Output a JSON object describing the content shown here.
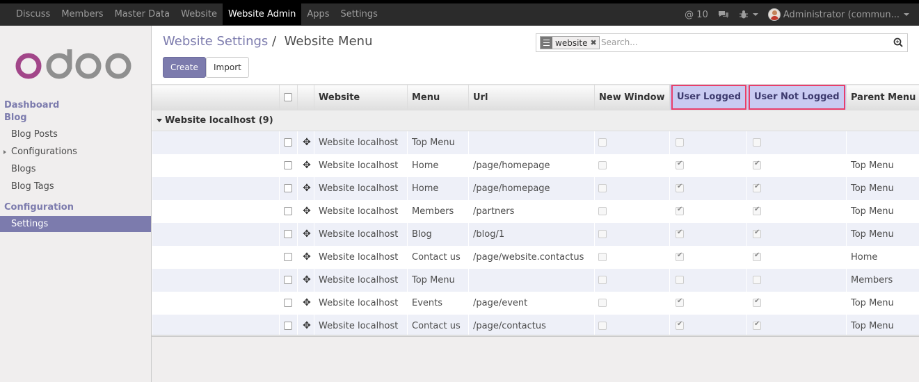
{
  "topbar": {
    "menu": [
      "Discuss",
      "Members",
      "Master Data",
      "Website",
      "Website Admin",
      "Apps",
      "Settings"
    ],
    "active_index": 4,
    "messages_count": "@ 10",
    "user": "Administrator (commun..."
  },
  "sidebar": {
    "sections": [
      {
        "title": "Dashboard"
      },
      {
        "title": "Blog",
        "items": [
          "Blog Posts",
          "Configurations",
          "Blogs",
          "Blog Tags"
        ]
      },
      {
        "title": "Configuration",
        "items": [
          "Settings"
        ]
      }
    ],
    "active": "Settings"
  },
  "breadcrumb": {
    "parent": "Website Settings",
    "sep": "/",
    "current": "Website Menu"
  },
  "buttons": {
    "create": "Create",
    "import": "Import"
  },
  "search": {
    "facet": "website",
    "placeholder": "Search..."
  },
  "table": {
    "columns": [
      "Website",
      "Menu",
      "Url",
      "New Window",
      "User Logged",
      "User Not Logged",
      "Parent Menu"
    ],
    "group_label": "Website localhost (9)",
    "rows": [
      {
        "website": "Website localhost",
        "menu": "Top Menu",
        "url": "",
        "new_window": false,
        "logged": false,
        "not_logged": false,
        "parent": ""
      },
      {
        "website": "Website localhost",
        "menu": "Home",
        "url": "/page/homepage",
        "new_window": false,
        "logged": true,
        "not_logged": true,
        "parent": "Top Menu"
      },
      {
        "website": "Website localhost",
        "menu": "Home",
        "url": "/page/homepage",
        "new_window": false,
        "logged": true,
        "not_logged": true,
        "parent": "Top Menu"
      },
      {
        "website": "Website localhost",
        "menu": "Members",
        "url": "/partners",
        "new_window": false,
        "logged": true,
        "not_logged": true,
        "parent": "Top Menu"
      },
      {
        "website": "Website localhost",
        "menu": "Blog",
        "url": "/blog/1",
        "new_window": false,
        "logged": true,
        "not_logged": true,
        "parent": "Top Menu"
      },
      {
        "website": "Website localhost",
        "menu": "Contact us",
        "url": "/page/website.contactus",
        "new_window": false,
        "logged": true,
        "not_logged": true,
        "parent": "Home"
      },
      {
        "website": "Website localhost",
        "menu": "Top Menu",
        "url": "",
        "new_window": false,
        "logged": false,
        "not_logged": false,
        "parent": "Members"
      },
      {
        "website": "Website localhost",
        "menu": "Events",
        "url": "/page/event",
        "new_window": false,
        "logged": true,
        "not_logged": true,
        "parent": "Top Menu"
      },
      {
        "website": "Website localhost",
        "menu": "Contact us",
        "url": "/page/contactus",
        "new_window": false,
        "logged": true,
        "not_logged": true,
        "parent": "Top Menu"
      }
    ]
  },
  "colors": {
    "brand": "#7c7bad",
    "highlight": "#e83e6b",
    "logo": "#a24689"
  }
}
